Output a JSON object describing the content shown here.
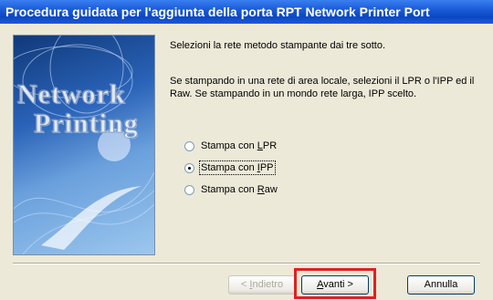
{
  "window": {
    "title": "Procedura guidata per l'aggiunta della porta RPT Network Printer Port"
  },
  "banner": {
    "line1": "Network",
    "line2": "Printing"
  },
  "intro": {
    "line1": "Selezioni la rete metodo stampante dai tre sotto.",
    "line2": "Se stampando in una rete di area locale, selezioni il LPR o l'IPP ed il Raw.  Se stampando in un mondo rete larga, IPP scelto."
  },
  "options": [
    {
      "pre": "Stampa con ",
      "key": "L",
      "post": "PR",
      "checked": false
    },
    {
      "pre": "Stampa con ",
      "key": "I",
      "post": "PP",
      "checked": true
    },
    {
      "pre": "Stampa con ",
      "key": "R",
      "post": "aw",
      "checked": false
    }
  ],
  "buttons": {
    "back": {
      "pre": "< ",
      "key": "I",
      "post": "ndietro"
    },
    "next": {
      "pre": "",
      "key": "A",
      "post": "vanti >"
    },
    "cancel": {
      "label": "Annulla"
    }
  },
  "colors": {
    "title_bar": "#0b47c4",
    "highlight": "#e02020"
  }
}
